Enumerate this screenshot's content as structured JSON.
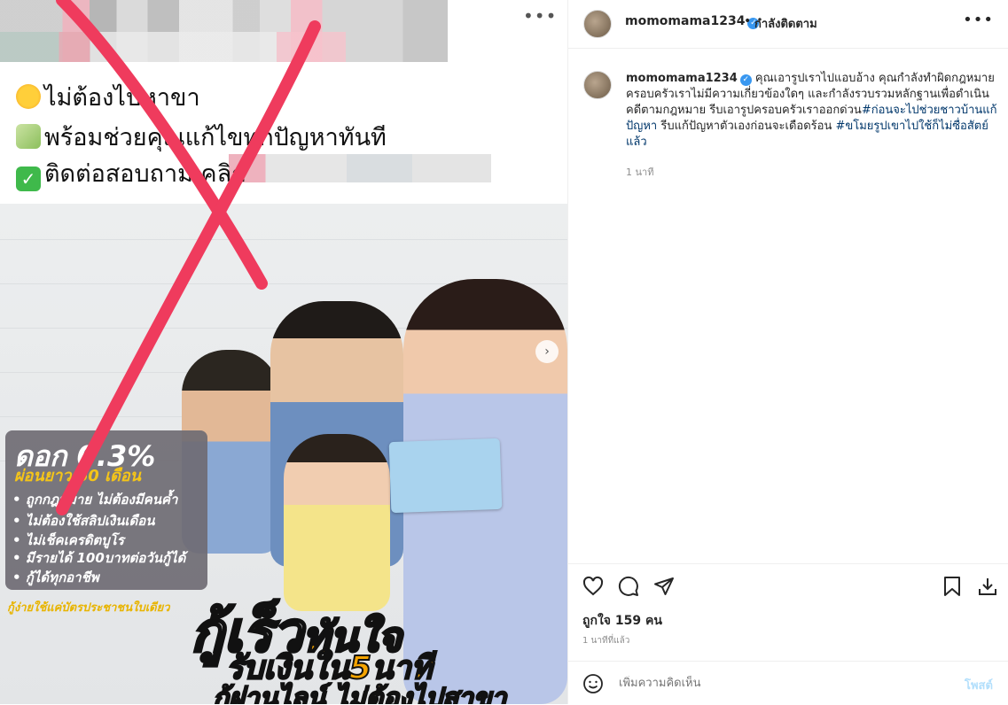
{
  "media": {
    "line1": "ไม่ต้องไปหาขา",
    "line2": "พร้อมช่วยคุณแก้ไขทุกปัญหาทันที",
    "line3": "ติดต่อสอบถาม คลิก",
    "more_label": "•••",
    "rate_title": "ดอก 0.3%",
    "rate_sub": "ผ่อนยาว 60 เดือน",
    "rate_items": [
      "• ถูกกฎหมาย ไม่ต้องมีคนค้ำ",
      "• ไม่ต้องใช้สลิปเงินเดือน",
      "• ไม่เช็คเครดิตบูโร",
      "• มีรายได้ 100บาทต่อวันกู้ได้",
      "• กู้ได้ทุกอาชีพ"
    ],
    "rate_footer": "กู้ง่ายใช้แค่บัตรประชาชนใบเดียว",
    "headline_a": "กู้เร็ว",
    "headline_b": "ทันใจ",
    "headline2": "รับเงินใน5นาที",
    "headline3_a": "กู้ผ่านไลน์ ",
    "headline3_b": "ไม่ต้องไปสาขา",
    "next_icon": "chevron-right-icon"
  },
  "header": {
    "username": "momomama1234",
    "verified_mark": "✓",
    "dot": "•",
    "follow_status": "กำลังติดตาม",
    "more_label": "•••"
  },
  "caption": {
    "username": "momomama1234",
    "text_plain1": " คุณเอารูปเราไปแอบอ้าง คุณกำลังทำผิดกฎหมาย ครอบครัวเราไม่มีความเกี่ยวข้องใดๆ และกำลังรวบรวมหลักฐานเพื่อดำเนินคดีตามกฎหมาย รีบเอารูปครอบครัวเราออกด่วน",
    "hashtag1": "#ก่อนจะไปช่วยชาวบ้านแก้ปัญหา",
    "text_plain2": " รีบแก้ปัญหาตัวเองก่อนจะเดือดร้อน ",
    "hashtag2": "#ขโมยรูปเขาไปใช้ก็ไม่ซื่อสัตย์แล้ว",
    "time": "1 นาที"
  },
  "actions": {
    "likes": "ถูกใจ 159 คน",
    "time": "1 นาทีที่แล้ว"
  },
  "comment": {
    "placeholder": "เพิ่มความคิดเห็น",
    "post_label": "โพสต์"
  },
  "colors": {
    "accent_link": "#00376b",
    "verified": "#3897f0",
    "cross_mark": "#ef3b5d",
    "post_disabled": "#b2dffc"
  }
}
